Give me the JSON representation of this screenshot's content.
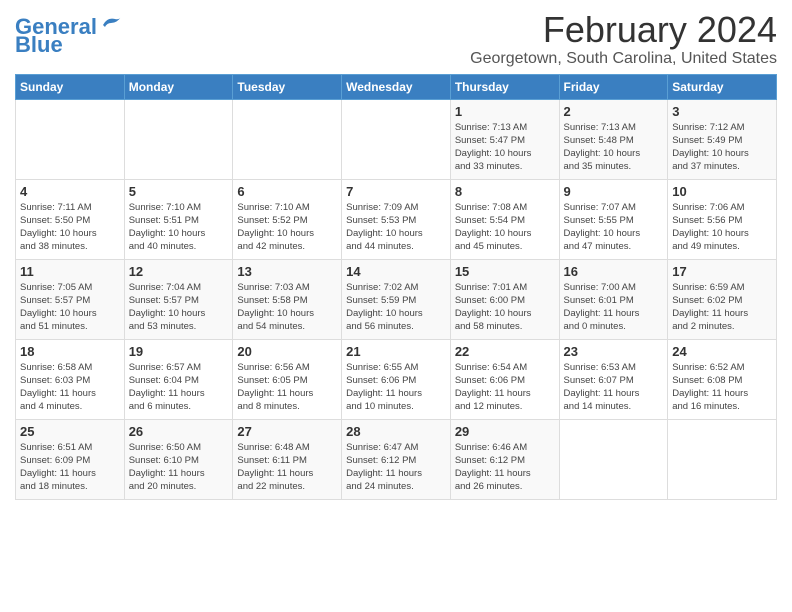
{
  "logo": {
    "line1": "General",
    "line2": "Blue"
  },
  "title": "February 2024",
  "subtitle": "Georgetown, South Carolina, United States",
  "days_of_week": [
    "Sunday",
    "Monday",
    "Tuesday",
    "Wednesday",
    "Thursday",
    "Friday",
    "Saturday"
  ],
  "weeks": [
    [
      {
        "day": "",
        "info": ""
      },
      {
        "day": "",
        "info": ""
      },
      {
        "day": "",
        "info": ""
      },
      {
        "day": "",
        "info": ""
      },
      {
        "day": "1",
        "info": "Sunrise: 7:13 AM\nSunset: 5:47 PM\nDaylight: 10 hours\nand 33 minutes."
      },
      {
        "day": "2",
        "info": "Sunrise: 7:13 AM\nSunset: 5:48 PM\nDaylight: 10 hours\nand 35 minutes."
      },
      {
        "day": "3",
        "info": "Sunrise: 7:12 AM\nSunset: 5:49 PM\nDaylight: 10 hours\nand 37 minutes."
      }
    ],
    [
      {
        "day": "4",
        "info": "Sunrise: 7:11 AM\nSunset: 5:50 PM\nDaylight: 10 hours\nand 38 minutes."
      },
      {
        "day": "5",
        "info": "Sunrise: 7:10 AM\nSunset: 5:51 PM\nDaylight: 10 hours\nand 40 minutes."
      },
      {
        "day": "6",
        "info": "Sunrise: 7:10 AM\nSunset: 5:52 PM\nDaylight: 10 hours\nand 42 minutes."
      },
      {
        "day": "7",
        "info": "Sunrise: 7:09 AM\nSunset: 5:53 PM\nDaylight: 10 hours\nand 44 minutes."
      },
      {
        "day": "8",
        "info": "Sunrise: 7:08 AM\nSunset: 5:54 PM\nDaylight: 10 hours\nand 45 minutes."
      },
      {
        "day": "9",
        "info": "Sunrise: 7:07 AM\nSunset: 5:55 PM\nDaylight: 10 hours\nand 47 minutes."
      },
      {
        "day": "10",
        "info": "Sunrise: 7:06 AM\nSunset: 5:56 PM\nDaylight: 10 hours\nand 49 minutes."
      }
    ],
    [
      {
        "day": "11",
        "info": "Sunrise: 7:05 AM\nSunset: 5:57 PM\nDaylight: 10 hours\nand 51 minutes."
      },
      {
        "day": "12",
        "info": "Sunrise: 7:04 AM\nSunset: 5:57 PM\nDaylight: 10 hours\nand 53 minutes."
      },
      {
        "day": "13",
        "info": "Sunrise: 7:03 AM\nSunset: 5:58 PM\nDaylight: 10 hours\nand 54 minutes."
      },
      {
        "day": "14",
        "info": "Sunrise: 7:02 AM\nSunset: 5:59 PM\nDaylight: 10 hours\nand 56 minutes."
      },
      {
        "day": "15",
        "info": "Sunrise: 7:01 AM\nSunset: 6:00 PM\nDaylight: 10 hours\nand 58 minutes."
      },
      {
        "day": "16",
        "info": "Sunrise: 7:00 AM\nSunset: 6:01 PM\nDaylight: 11 hours\nand 0 minutes."
      },
      {
        "day": "17",
        "info": "Sunrise: 6:59 AM\nSunset: 6:02 PM\nDaylight: 11 hours\nand 2 minutes."
      }
    ],
    [
      {
        "day": "18",
        "info": "Sunrise: 6:58 AM\nSunset: 6:03 PM\nDaylight: 11 hours\nand 4 minutes."
      },
      {
        "day": "19",
        "info": "Sunrise: 6:57 AM\nSunset: 6:04 PM\nDaylight: 11 hours\nand 6 minutes."
      },
      {
        "day": "20",
        "info": "Sunrise: 6:56 AM\nSunset: 6:05 PM\nDaylight: 11 hours\nand 8 minutes."
      },
      {
        "day": "21",
        "info": "Sunrise: 6:55 AM\nSunset: 6:06 PM\nDaylight: 11 hours\nand 10 minutes."
      },
      {
        "day": "22",
        "info": "Sunrise: 6:54 AM\nSunset: 6:06 PM\nDaylight: 11 hours\nand 12 minutes."
      },
      {
        "day": "23",
        "info": "Sunrise: 6:53 AM\nSunset: 6:07 PM\nDaylight: 11 hours\nand 14 minutes."
      },
      {
        "day": "24",
        "info": "Sunrise: 6:52 AM\nSunset: 6:08 PM\nDaylight: 11 hours\nand 16 minutes."
      }
    ],
    [
      {
        "day": "25",
        "info": "Sunrise: 6:51 AM\nSunset: 6:09 PM\nDaylight: 11 hours\nand 18 minutes."
      },
      {
        "day": "26",
        "info": "Sunrise: 6:50 AM\nSunset: 6:10 PM\nDaylight: 11 hours\nand 20 minutes."
      },
      {
        "day": "27",
        "info": "Sunrise: 6:48 AM\nSunset: 6:11 PM\nDaylight: 11 hours\nand 22 minutes."
      },
      {
        "day": "28",
        "info": "Sunrise: 6:47 AM\nSunset: 6:12 PM\nDaylight: 11 hours\nand 24 minutes."
      },
      {
        "day": "29",
        "info": "Sunrise: 6:46 AM\nSunset: 6:12 PM\nDaylight: 11 hours\nand 26 minutes."
      },
      {
        "day": "",
        "info": ""
      },
      {
        "day": "",
        "info": ""
      }
    ]
  ]
}
